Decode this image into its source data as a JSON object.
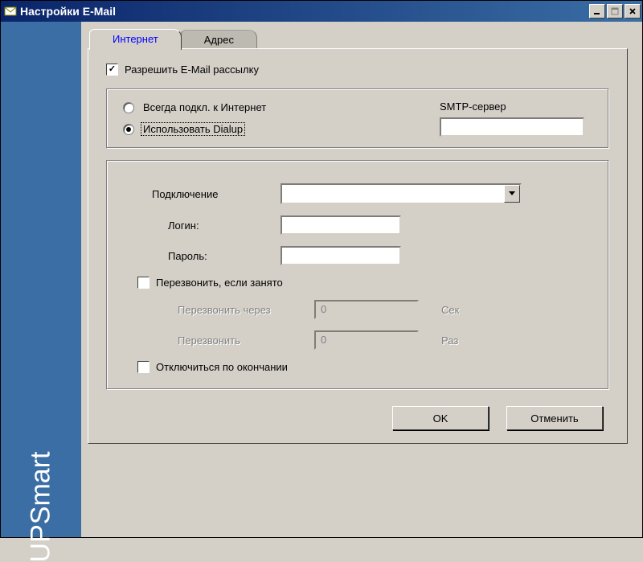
{
  "window": {
    "title": "Настройки E-Mail"
  },
  "sidebar": {
    "brand": "UPSmart"
  },
  "tabs": {
    "internet": "Интернет",
    "address": "Адрес"
  },
  "main": {
    "enable_mail_label": "Разрешить E-Mail рассылку",
    "radio_always": "Всегда подкл. к Интернет",
    "radio_dialup": "Использовать Dialup",
    "smtp_label": "SMTP-сервер",
    "smtp_value": "",
    "connection_label": "Подключение",
    "connection_value": "",
    "login_label": "Логин:",
    "login_value": "",
    "password_label": "Пароль:",
    "password_value": "",
    "redial_label": "Перезвонить, если занято",
    "redial_after_label": "Перезвонить через",
    "redial_after_value": "0",
    "redial_after_unit": "Сек",
    "redial_times_label": "Перезвонить",
    "redial_times_value": "0",
    "redial_times_unit": "Раз",
    "disconnect_label": "Отключиться по окончании"
  },
  "buttons": {
    "ok": "OK",
    "cancel": "Отменить"
  }
}
